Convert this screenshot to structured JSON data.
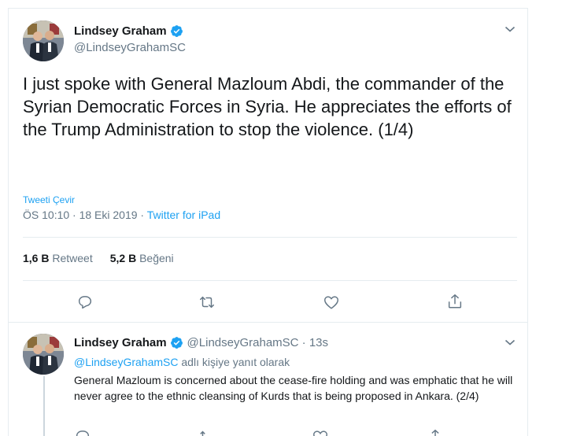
{
  "main_tweet": {
    "author_name": "Lindsey Graham",
    "author_handle": "@LindseyGrahamSC",
    "text": "I just spoke with General Mazloum Abdi, the commander of the Syrian Democratic Forces in Syria. He appreciates the efforts of the Trump Administration to stop the violence. (1/4)",
    "translate_label": "Tweeti Çevir",
    "timestamp": "ÖS 10:10 · 18 Eki 2019 · ",
    "source": "Twitter for iPad",
    "retweet_count": "1,6 B",
    "retweet_label": "Retweet",
    "like_count": "5,2 B",
    "like_label": "Beğeni"
  },
  "reply_tweet": {
    "author_name": "Lindsey Graham",
    "author_handle": "@LindseyGrahamSC · 13s",
    "replying_mention": "@LindseyGrahamSC",
    "replying_suffix": " adlı kişiye yanıt olarak",
    "text": "General Mazloum is concerned about the cease-fire holding and was emphatic that he will never agree to the ethnic cleansing of Kurds that is being proposed in Ankara. (2/4)"
  },
  "icons": {
    "verified": "verified-badge-icon",
    "menu": "chevron-down-icon",
    "reply": "reply-icon",
    "retweet": "retweet-icon",
    "like": "heart-icon",
    "share": "share-icon"
  },
  "colors": {
    "accent": "#1da1f2",
    "secondary_text": "#657786",
    "border": "#e6ecf0"
  }
}
